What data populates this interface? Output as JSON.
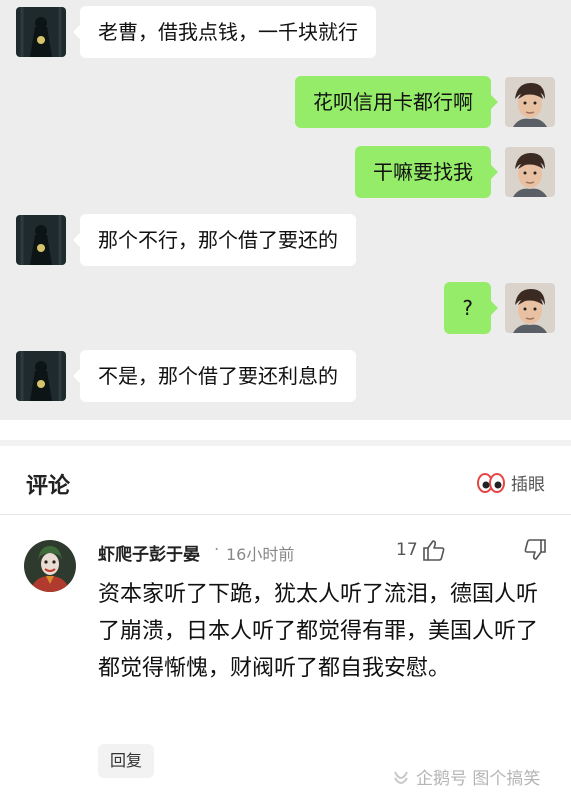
{
  "chat": {
    "messages": [
      {
        "side": "left",
        "text": "老曹，借我点钱，一千块就行"
      },
      {
        "side": "right",
        "text": "花呗信用卡都行啊"
      },
      {
        "side": "right",
        "text": "干嘛要找我"
      },
      {
        "side": "left",
        "text": "那个不行，那个借了要还的"
      },
      {
        "side": "right",
        "text": "?"
      },
      {
        "side": "left",
        "text": "不是，那个借了要还利息的"
      }
    ]
  },
  "comments": {
    "title": "评论",
    "insert_eye_label": "插眼",
    "items": [
      {
        "username": "虾爬子彭于晏",
        "separator": "·",
        "time": "16小时前",
        "likes": "17",
        "text": "资本家听了下跪，犹太人听了流泪，德国人听了崩溃，日本人听了都觉得有罪，美国人听了都觉得惭愧，财阀听了都自我安慰。",
        "reply_label": "回复"
      }
    ]
  },
  "watermark": "企鹅号 图个搞笑",
  "colors": {
    "chat_bg": "#ededed",
    "bubble_left": "#ffffff",
    "bubble_right": "#95ec69"
  },
  "icons": {
    "left_avatar": "dark-figure-avatar",
    "right_avatar": "man-portrait-avatar",
    "comment_avatar": "joker-avatar",
    "insert_eye": "eyes-icon",
    "like": "thumbs-up-icon",
    "dislike": "thumbs-down-icon",
    "watermark": "penguin-icon"
  }
}
